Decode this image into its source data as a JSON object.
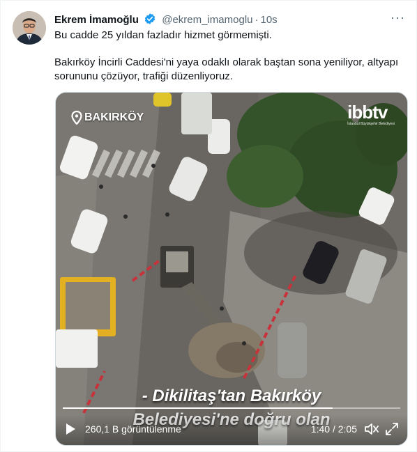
{
  "tweet": {
    "author_name": "Ekrem İmamoğlu",
    "handle": "@ekrem_imamoglu",
    "separator": "·",
    "time": "10s",
    "more_label": "···",
    "text_line1": "Bu cadde 25 yıldan fazladır hizmet görmemişti.",
    "text_line2": "Bakırköy İncirli Caddesi'ni yaya odaklı olarak baştan sona yeniliyor, altyapı sorununu çözüyor, trafiği düzenliyoruz."
  },
  "video": {
    "location_label": "BAKIRKÖY",
    "logo_text": "ibbtv",
    "logo_subtext": "İstanbul Büyükşehir Belediyesi",
    "subtitle_line1": "- Dikilitaş'tan Bakırköy",
    "subtitle_line2": "Belediyesi'ne doğru olan",
    "views": "260,1 B görüntülenme",
    "current_time": "1:40",
    "time_separator": "/",
    "duration": "2:05",
    "progress": 0.8
  },
  "colors": {
    "verified": "#1d9bf0",
    "text_secondary": "#536471"
  },
  "icons": [
    "verified-icon",
    "more-icon",
    "location-pin-icon",
    "play-icon",
    "volume-icon",
    "fullscreen-icon"
  ]
}
